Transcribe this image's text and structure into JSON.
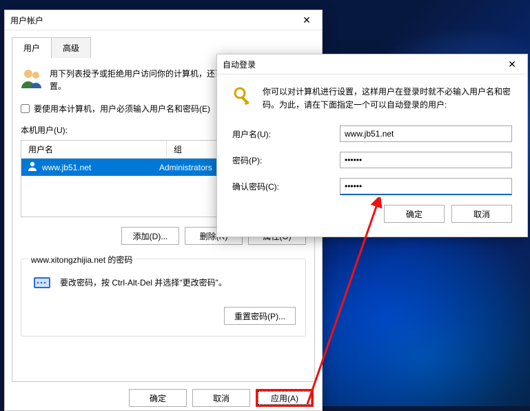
{
  "main": {
    "title": "用户帐户",
    "tabs": {
      "users": "用户",
      "advanced": "高级"
    },
    "intro": "用下列表授予或拒绝用户访问你的计算机，还可以更改其密码和其他设置。",
    "require_checkbox": "要使用本计算机，用户必须输入用户名和密码(E)",
    "list_label": "本机用户(U):",
    "columns": {
      "name": "用户名",
      "group": "组"
    },
    "users": [
      {
        "name": "www.jb51.net",
        "group": "Administrators"
      }
    ],
    "buttons": {
      "add": "添加(D)...",
      "remove": "删除(R)",
      "properties": "属性(O)"
    },
    "password_group": {
      "legend": "www.xitongzhijia.net 的密码",
      "hint": "要改密码，按 Ctrl-Alt-Del 并选择\"更改密码\"。",
      "reset": "重置密码(P)..."
    },
    "bottom": {
      "ok": "确定",
      "cancel": "取消",
      "apply": "应用(A)"
    }
  },
  "dialog": {
    "title": "自动登录",
    "intro": "你可以对计算机进行设置，这样用户在登录时就不必输入用户名和密码。为此，请在下面指定一个可以自动登录的用户:",
    "labels": {
      "user": "用户名(U):",
      "password": "密码(P):",
      "confirm": "确认密码(C):"
    },
    "values": {
      "user": "www.jb51.net",
      "password": "••••••",
      "confirm": "••••••"
    },
    "buttons": {
      "ok": "确定",
      "cancel": "取消"
    }
  }
}
